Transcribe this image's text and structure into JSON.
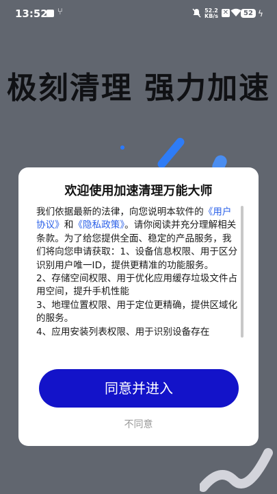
{
  "status_bar": {
    "time": "13:52",
    "network_speed_value": "52.2",
    "network_speed_unit": "KB/s",
    "battery_level": "52",
    "icons": [
      "app-notification-icon",
      "usb-icon",
      "mute-icon",
      "sim-icon",
      "wifi-icon",
      "battery-icon",
      "charging-icon"
    ]
  },
  "hero": {
    "title": "极刻清理  强力加速"
  },
  "dialog": {
    "title": "欢迎使用加速清理万能大师",
    "body_intro": "我们依据最新的法律，向您说明本软件的",
    "user_agreement_link": "《用户协议》",
    "and_text": "和",
    "privacy_policy_link": "《隐私政策》",
    "body_rest": "。请你阅读并充分理解相关条款。为了给您提供全面、稳定的产品服务，我们将向您申请获取：1、设备信息权限、用于区分识别用户唯一ID，提供更精准的功能服务。",
    "item_2": "2、存储空间权限、用于优化应用缓存垃圾文件占用空间，提升手机性能",
    "item_3": "3、地理位置权限、用于定位更精确，提供区域化的服务。",
    "item_4": "4、应用安装列表权限、用于识别设备存在",
    "agree_label": "同意并进入",
    "disagree_label": "不同意"
  },
  "colors": {
    "background": "#61666f",
    "primary_button": "#1313c9",
    "link": "#2a60e8",
    "decor_blue": "#2e7cf6"
  }
}
